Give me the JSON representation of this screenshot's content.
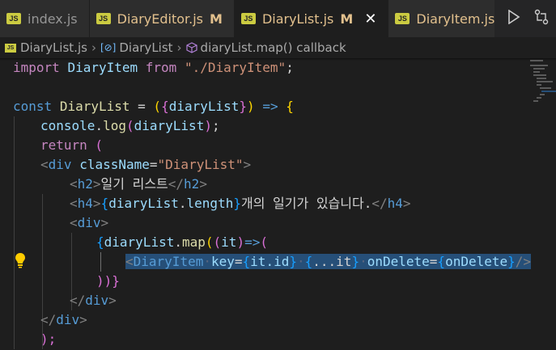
{
  "tabs": [
    {
      "name": "index.js",
      "modified": false,
      "active": false
    },
    {
      "name": "DiaryEditor.js",
      "modified": true,
      "marker": "M",
      "active": false
    },
    {
      "name": "DiaryList.js",
      "modified": true,
      "marker": "M",
      "active": true
    },
    {
      "name": "DiaryItem.js",
      "modified": true,
      "active": false
    }
  ],
  "tab_icon_text": "JS",
  "close_glyph": "✕",
  "breadcrumb": {
    "file": "DiaryList.js",
    "symbol": "DiaryList",
    "callback": "diaryList.map() callback"
  },
  "code": {
    "l1": {
      "kw": "import",
      "id": "DiaryItem",
      "from": "from",
      "str": "\"./DiaryItem\"",
      "end": ";"
    },
    "l3": {
      "const": "const",
      "name": "DiaryList",
      "eq": " = ",
      "open": "(",
      "brace": "{",
      "param": "diaryList",
      "brace_close": "}",
      "close": ")",
      "arrow": " => ",
      "block": "{"
    },
    "l4": {
      "obj": "console",
      "dot": ".",
      "fn": "log",
      "open": "(",
      "arg": "diaryList",
      "close": ")",
      "end": ";"
    },
    "l5": {
      "kw": "return",
      "open": " ("
    },
    "l6": {
      "open": "<",
      "tag": "div",
      "attr": "className",
      "eq": "=",
      "val": "\"DiaryList\"",
      "close": ">"
    },
    "l7": {
      "open": "<",
      "tag": "h2",
      "close": ">",
      "text": "일기 리스트",
      "end_open": "</",
      "end_tag": "h2",
      "end_close": ">"
    },
    "l8": {
      "open": "<",
      "tag": "h4",
      "close": ">",
      "brace": "{",
      "expr_obj": "diaryList",
      "dot": ".",
      "expr_prop": "length",
      "brace_close": "}",
      "text": "개의 일기가 있습니다.",
      "end_open": "</",
      "end_tag": "h4",
      "end_close": ">"
    },
    "l9": {
      "open": "<",
      "tag": "div",
      "close": ">"
    },
    "l10": {
      "brace": "{",
      "obj": "diaryList",
      "dot": ".",
      "fn": "map",
      "open": "(",
      "open2": "(",
      "param": "it",
      "close2": ")",
      "arrow": "=>",
      "open3": "("
    },
    "l11": {
      "open": "<",
      "tag": "DiaryItem",
      "key": "key",
      "eq": "=",
      "b1": "{",
      "key_val": "it.id",
      "b1c": "}",
      "b2": "{",
      "spread": "...it",
      "b2c": "}",
      "attr": "onDelete",
      "eq2": "=",
      "b3": "{",
      "attr_val": "onDelete",
      "b3c": "}",
      "close": "/>"
    },
    "l12": {
      "close": "))}"
    },
    "l13": {
      "end_open": "</",
      "end_tag": "div",
      "end_close": ">"
    },
    "l14": {
      "end_open": "</",
      "end_tag": "div",
      "end_close": ">"
    },
    "l15": {
      "close": ");"
    }
  },
  "colors": {
    "accent_modified": "#e2c08d",
    "js_badge": "#cbcb41",
    "selection": "#264f78",
    "lightbulb": "#ffcc00"
  }
}
